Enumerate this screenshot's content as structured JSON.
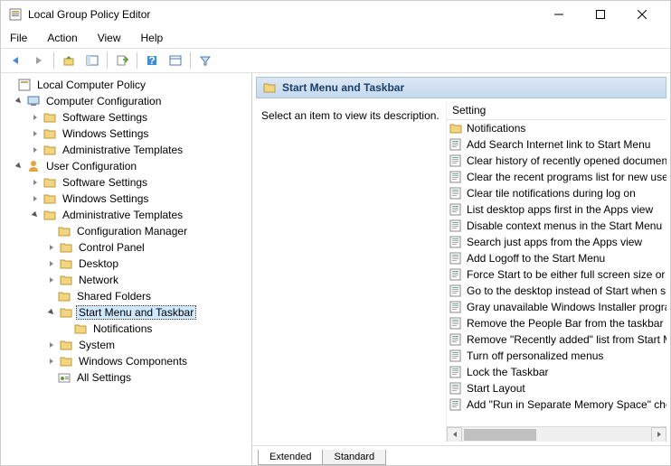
{
  "window": {
    "title": "Local Group Policy Editor"
  },
  "menu": {
    "file": "File",
    "action": "Action",
    "view": "View",
    "help": "Help"
  },
  "tree": {
    "root": "Local Computer Policy",
    "comp_config": "Computer Configuration",
    "cc_soft": "Software Settings",
    "cc_win": "Windows Settings",
    "cc_admin": "Administrative Templates",
    "user_config": "User Configuration",
    "uc_soft": "Software Settings",
    "uc_win": "Windows Settings",
    "uc_admin": "Administrative Templates",
    "cfg_mgr": "Configuration Manager",
    "ctrl_panel": "Control Panel",
    "desktop": "Desktop",
    "network": "Network",
    "shared": "Shared Folders",
    "start_menu": "Start Menu and Taskbar",
    "notifications": "Notifications",
    "system": "System",
    "win_comp": "Windows Components",
    "all_settings": "All Settings"
  },
  "right_header": "Start Menu and Taskbar",
  "desc_placeholder": "Select an item to view its description.",
  "list_header": "Setting",
  "settings": [
    "Notifications",
    "Add Search Internet link to Start Menu",
    "Clear history of recently opened documents on",
    "Clear the recent programs list for new users",
    "Clear tile notifications during log on",
    "List desktop apps first in the Apps view",
    "Disable context menus in the Start Menu",
    "Search just apps from the Apps view",
    "Add Logoff to the Start Menu",
    "Force Start to be either full screen size or menu",
    "Go to the desktop instead of Start when signing",
    "Gray unavailable Windows Installer programs St",
    "Remove the People Bar from the taskbar",
    "Remove \"Recently added\" list from Start Menu",
    "Turn off personalized menus",
    "Lock the Taskbar",
    "Start Layout",
    "Add \"Run in Separate Memory Space\" check bo"
  ],
  "tabs": {
    "extended": "Extended",
    "standard": "Standard"
  }
}
